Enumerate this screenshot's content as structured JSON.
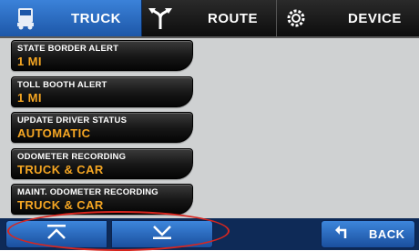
{
  "tabs": [
    {
      "label": "TRUCK",
      "icon": "truck-icon",
      "selected": true
    },
    {
      "label": "ROUTE",
      "icon": "route-fork-icon",
      "selected": false
    },
    {
      "label": "DEVICE",
      "icon": "gear-icon",
      "selected": false
    }
  ],
  "settings": [
    {
      "label": "STATE BORDER ALERT",
      "value": "1 MI"
    },
    {
      "label": "TOLL BOOTH ALERT",
      "value": "1 MI"
    },
    {
      "label": "UPDATE DRIVER STATUS",
      "value": "AUTOMATIC"
    },
    {
      "label": "ODOMETER RECORDING",
      "value": "TRUCK & CAR"
    },
    {
      "label": "MAINT. ODOMETER RECORDING",
      "value": "TRUCK & CAR"
    }
  ],
  "bottom": {
    "up_icon": "scroll-to-top-icon",
    "down_icon": "scroll-down-icon",
    "back_label": "BACK",
    "back_icon": "back-arrow-icon"
  },
  "colors": {
    "tab_selected": "#2f6fc4",
    "value_text": "#f5a623",
    "highlight": "#d8261f",
    "screen_bg": "#cfd1d2"
  }
}
